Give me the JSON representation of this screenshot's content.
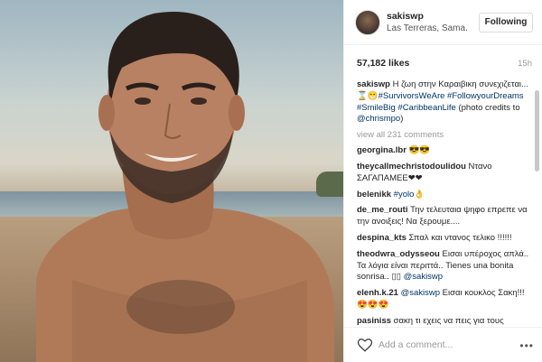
{
  "post": {
    "username": "sakiswp",
    "location": "Las Terreras, Sama...",
    "follow_label": "Following",
    "likes": "57,182 likes",
    "age": "15h"
  },
  "caption": {
    "username": "sakiswp",
    "text": " Η ζωη στην Καραιβικη συνεχιζεται... ⌛😁",
    "tags": "#SurvivorsWeAre #FollowyourDreams #SmileBig #CaribbeanLife",
    "credits": " (photo credits to ",
    "credit_user": "@chrismpo",
    "credits_end": ")"
  },
  "view_all": "view all 231 comments",
  "comments": [
    {
      "user": "georgina.lbr",
      "text": " 😎😎"
    },
    {
      "user": "theycallmechristodoulidou",
      "text": " Ντανο ΣΑΓΑΠΑΜΕΕ❤❤"
    },
    {
      "user": "belenikk",
      "text": " ",
      "link": "#yolo👌"
    },
    {
      "user": "de_me_routi",
      "text": " Την τελευταια ψηφο επρεπε να την ανοιξεις! Να ξερουμε...."
    },
    {
      "user": "despina_kts",
      "text": " Σπαλ και ντανος τελικο !!!!!!"
    },
    {
      "user": "theodwra_odysseou",
      "text": " Εισαι υπέροχος απλά.. Τα λόγια είναι περιττά.. Tienes una bonita sonrisa.. ▯▯ ",
      "link": "@sakiswp"
    },
    {
      "user": "elenh.k.21",
      "text": " ",
      "link": "@sakiswp",
      "tail": " Εισαι κουκλος Σακη!!!😍😍😍"
    },
    {
      "user": "pasiniss",
      "text": " σακη τι εχεις να πεις για τους"
    }
  ],
  "add_comment_placeholder": "Add a comment...",
  "more_label": "•••"
}
